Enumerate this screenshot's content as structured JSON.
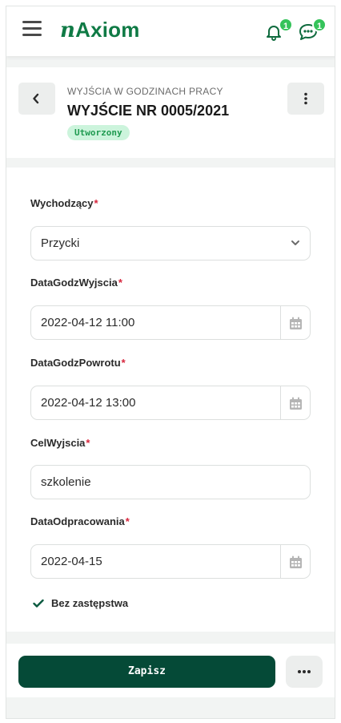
{
  "app": {
    "logo_prefix": "n",
    "logo_text": "Axiom",
    "notifications_count": "1",
    "messages_count": "1",
    "brand_color": "#0f7a45"
  },
  "header": {
    "breadcrumb": "WYJŚCIA W GODZINACH PRACY",
    "title": "WYJŚCIE NR 0005/2021",
    "status": "Utworzony",
    "status_color": "#1f9a50"
  },
  "form": {
    "required_mark": "*",
    "wychodzacy": {
      "label": "Wychodzący",
      "value": "Przycki"
    },
    "data_godz_wyjscia": {
      "label": "DataGodzWyjscia",
      "value": "2022-04-12 11:00"
    },
    "data_godz_powrotu": {
      "label": "DataGodzPowrotu",
      "value": "2022-04-12 13:00"
    },
    "cel_wyjscia": {
      "label": "CelWyjscia",
      "value": "szkolenie"
    },
    "data_odpracowania": {
      "label": "DataOdpracowania",
      "value": "2022-04-15"
    },
    "bez_zastepstwa": {
      "label": "Bez zastępstwa",
      "checked": true
    }
  },
  "footer": {
    "save_label": "Zapisz",
    "primary_color": "#054a37"
  },
  "icons": {
    "menu": "hamburger-icon",
    "notifications": "bell-icon",
    "messages": "chat-bubble-icon",
    "back": "chevron-left-icon",
    "more_vertical": "kebab-vertical-icon",
    "dropdown": "chevron-down-icon",
    "calendar": "calendar-icon",
    "check": "check-icon",
    "more_horizontal": "ellipsis-horizontal-icon"
  }
}
